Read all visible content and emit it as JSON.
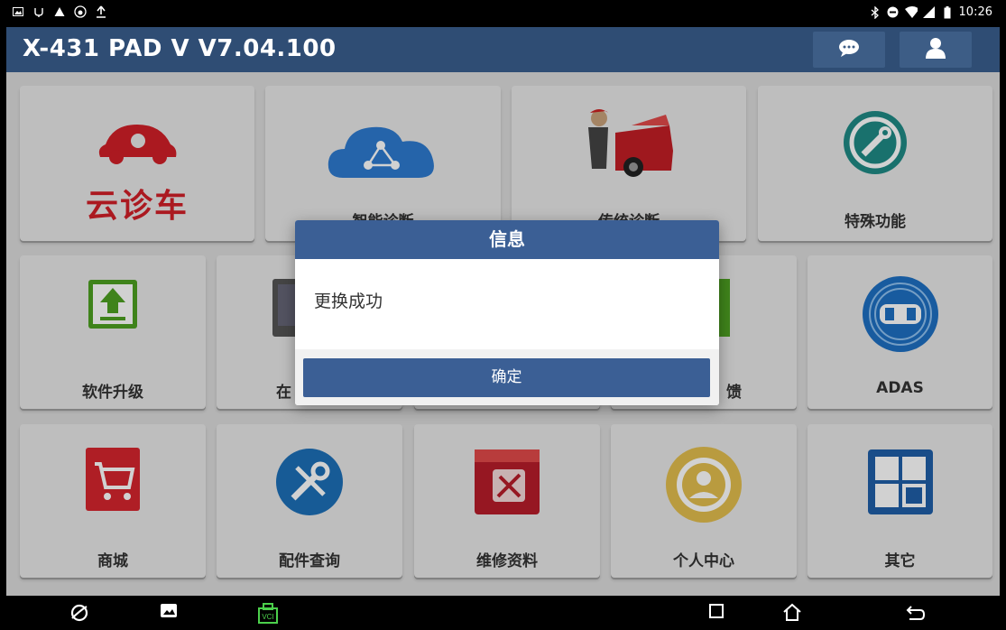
{
  "status_bar": {
    "time": "10:26"
  },
  "app_bar": {
    "title": "X-431 PAD V V7.04.100"
  },
  "tiles": {
    "cloud": {
      "label": "云诊车"
    },
    "smart_diag": {
      "label": "智能诊断"
    },
    "traditional_diag": {
      "label": "传统诊断"
    },
    "special_func": {
      "label": "特殊功能"
    },
    "software_upgrade": {
      "label": "软件升级"
    },
    "online": {
      "label": "在"
    },
    "feedback": {
      "label": "馈"
    },
    "adas": {
      "label": "ADAS"
    },
    "mall": {
      "label": "商城"
    },
    "parts_query": {
      "label": "配件查询"
    },
    "repair_info": {
      "label": "维修资料"
    },
    "personal_center": {
      "label": "个人中心"
    },
    "other": {
      "label": "其它"
    }
  },
  "dialog": {
    "title": "信息",
    "message": "更换成功",
    "confirm_label": "确定"
  },
  "nav_bar": {
    "vci_label": "VCI"
  },
  "colors": {
    "app_bar": "#2f4d74",
    "dialog_header": "#3b5f95",
    "tile_bg": "#e8e8e8",
    "brand_red": "#d11f28"
  }
}
